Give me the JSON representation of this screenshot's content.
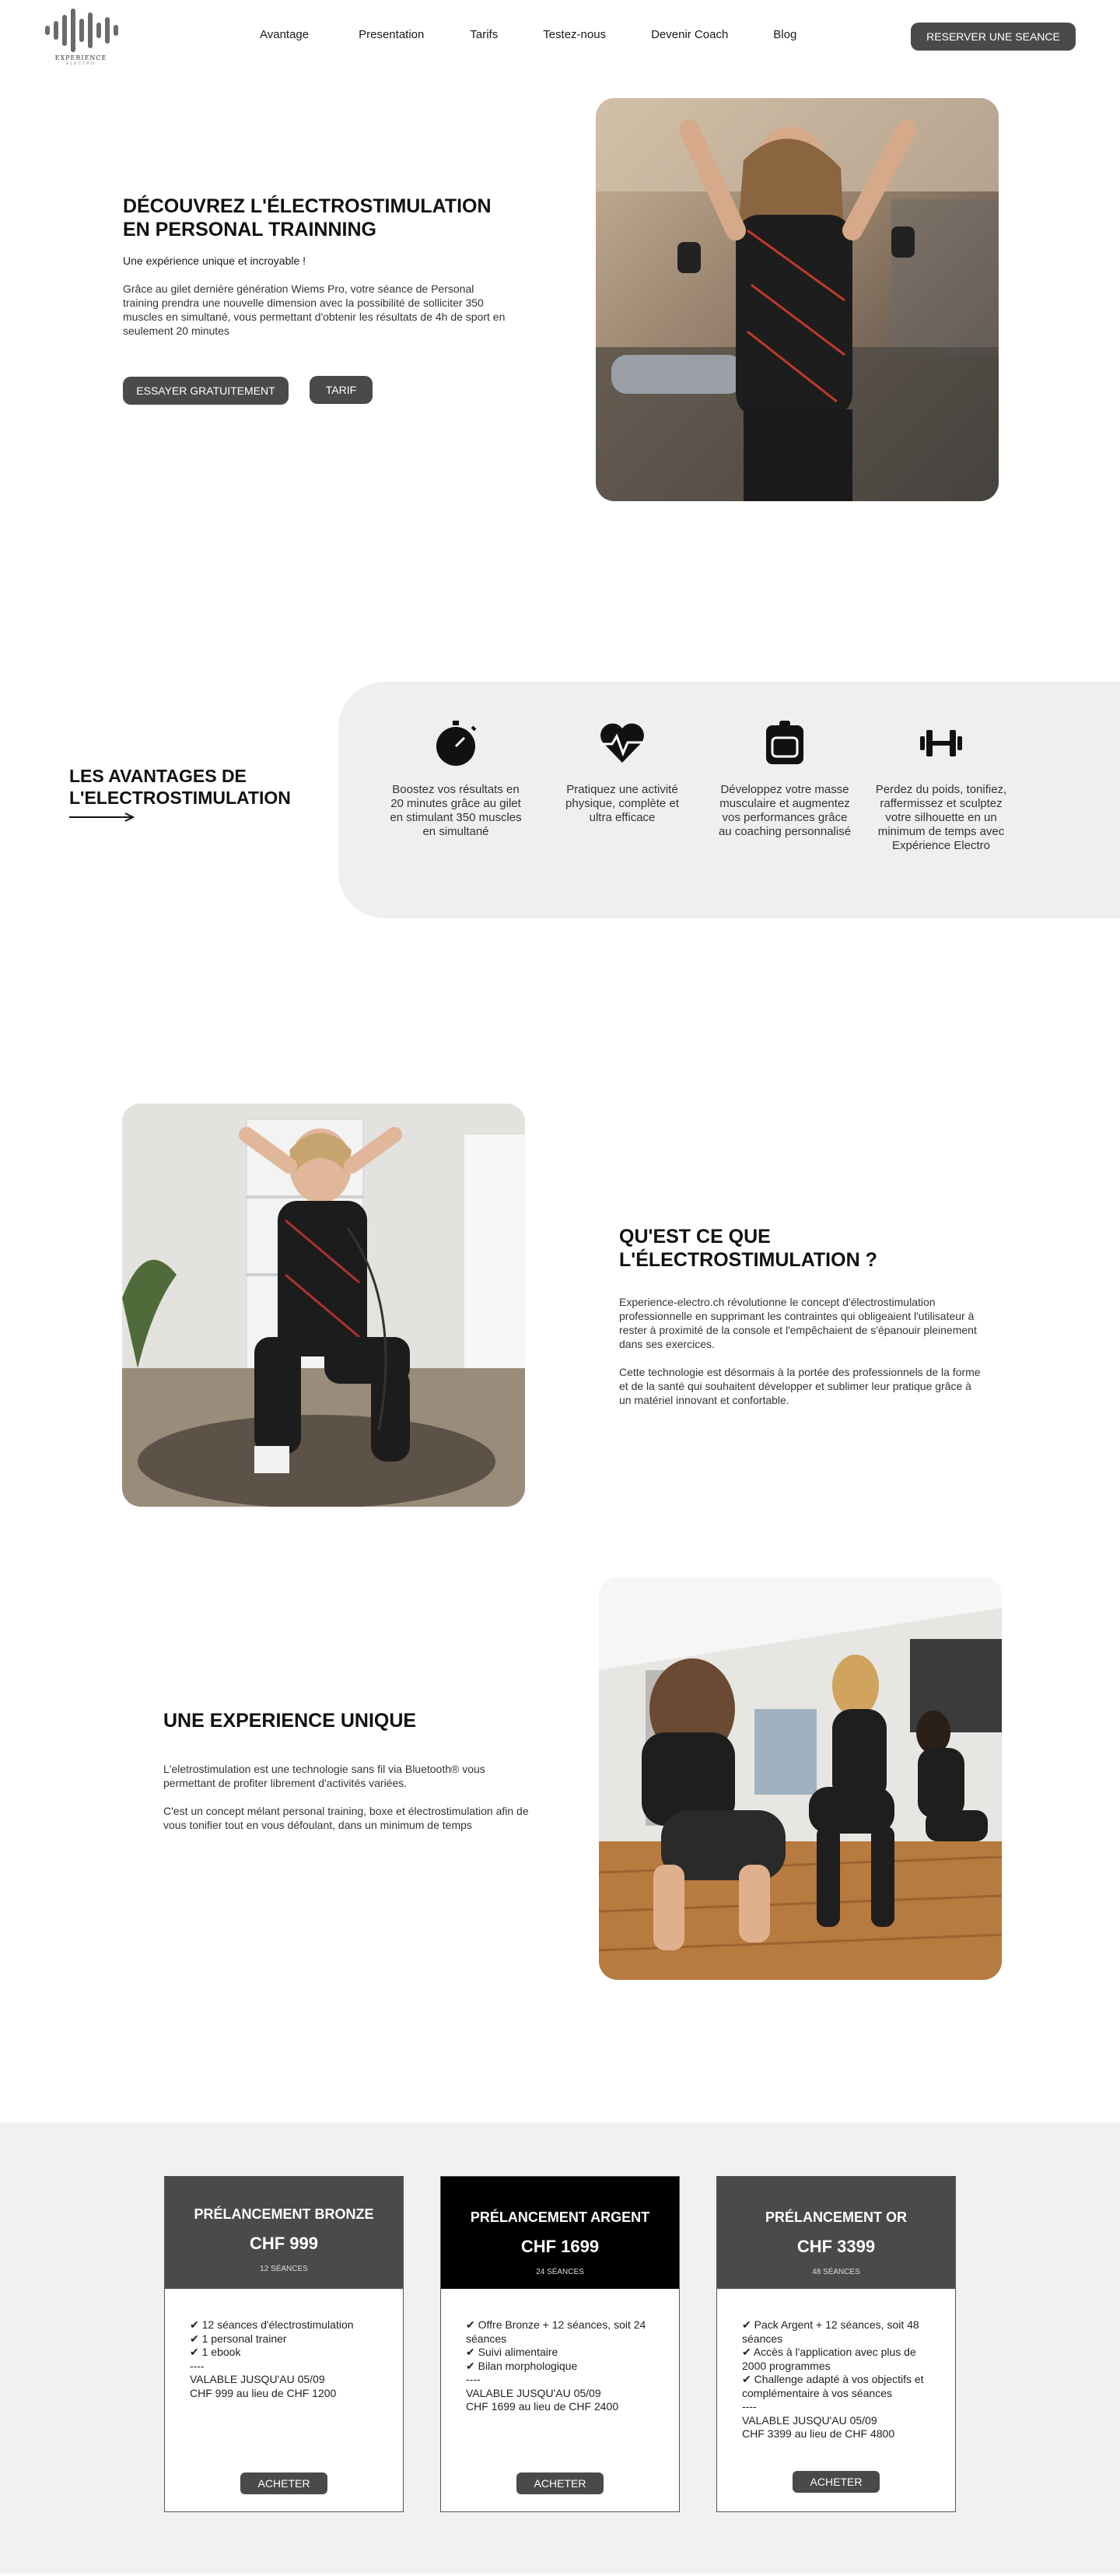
{
  "header": {
    "logo_text": "EXPERIENCE",
    "logo_sub": "ELECTRO",
    "nav": [
      "Avantage",
      "Presentation",
      "Tarifs",
      "Testez-nous",
      "Devenir Coach",
      "Blog"
    ],
    "reserve_label": "RESERVER UNE SEANCE"
  },
  "hero": {
    "title": "DÉCOUVREZ L'ÉLECTROSTIMULATION EN PERSONAL TRAINNING",
    "lead": "Une expérience unique et incroyable !",
    "body": "Grâce au gilet dernière génération Wiems Pro, votre séance de Personal training prendra une nouvelle dimension avec la possibilité de solliciter 350 muscles en simultané, vous permettant d'obtenir les résultats de 4h de sport en seulement 20 minutes",
    "try_label": "ESSAYER GRATUITEMENT",
    "tarif_label": "TARIF"
  },
  "advantages": {
    "title": "LES AVANTAGES DE L'ELECTROSTIMULATION",
    "items": [
      {
        "icon": "stopwatch-icon",
        "text": "Boostez vos résultats en 20 minutes grâce au gilet en stimulant 350 muscles en simultané"
      },
      {
        "icon": "heartbeat-icon",
        "text": "Pratiquez une activité physique, complète et ultra efficace"
      },
      {
        "icon": "scale-icon",
        "text": "Développez votre masse musculaire et augmentez vos performances grâce au coaching personnalisé"
      },
      {
        "icon": "dumbbell-icon",
        "text": "Perdez du poids, tonifiez, raffermissez et sculptez votre silhouette en un minimum de temps avec Expérience Electro"
      }
    ]
  },
  "what_is": {
    "title": "QU'EST CE QUE L'ÉLECTROSTIMULATION ?",
    "p1": "Experience-electro.ch révolutionne le concept d'électrostimulation professionnelle en supprimant les contraintes qui obligeaient l'utilisateur à rester à proximité de la console et l'empêchaient de s'épanouir pleinement dans ses exercices.",
    "p2": "Cette technologie est désormais à la portée des professionnels de la forme et de la santé qui souhaitent développer et sublimer leur pratique grâce à un matériel innovant et confortable."
  },
  "unique": {
    "title": "UNE EXPERIENCE UNIQUE",
    "p1": "L'eletrostimulation est une technologie sans fil via Bluetooth® vous permettant de profiter librement d'activités variées.",
    "p2": "C'est un concept mélant personal training, boxe et électrostimulation afin de vous tonifier tout en vous défoulant, dans un minimum de temps"
  },
  "pricing": {
    "cards": [
      {
        "name": "PRÉLANCEMENT BRONZE",
        "price": "CHF 999",
        "sessions": "12 SÉANCES",
        "head_color": "#4a4a4a",
        "details": "✔ 12 séances d'électrostimulation\n✔ 1 personal trainer\n✔ 1 ebook\n----\nVALABLE JUSQU'AU 05/09\nCHF 999 au lieu de CHF 1200",
        "button": "ACHETER"
      },
      {
        "name": "PRÉLANCEMENT ARGENT",
        "price": "CHF 1699",
        "sessions": "24 SÉANCES",
        "head_color": "#000000",
        "details": "✔ Offre Bronze + 12 séances, soit 24 séances\n✔ Suivi alimentaire\n✔ Bilan morphologique\n----\nVALABLE JUSQU'AU 05/09\nCHF 1699 au lieu de CHF 2400",
        "button": "ACHETER"
      },
      {
        "name": "PRÉLANCEMENT OR",
        "price": "CHF 3399",
        "sessions": "48 SÉANCES",
        "head_color": "#4a4a4a",
        "details": "✔ Pack Argent + 12 séances, soit 48 séances\n✔ Accès à l'application avec plus de 2000 programmes\n✔ Challenge adapté à vos objectifs et complémentaire à vos séances\n----\nVALABLE JUSQU'AU 05/09\nCHF 3399 au lieu de CHF 4800",
        "button": "ACHETER"
      }
    ]
  }
}
